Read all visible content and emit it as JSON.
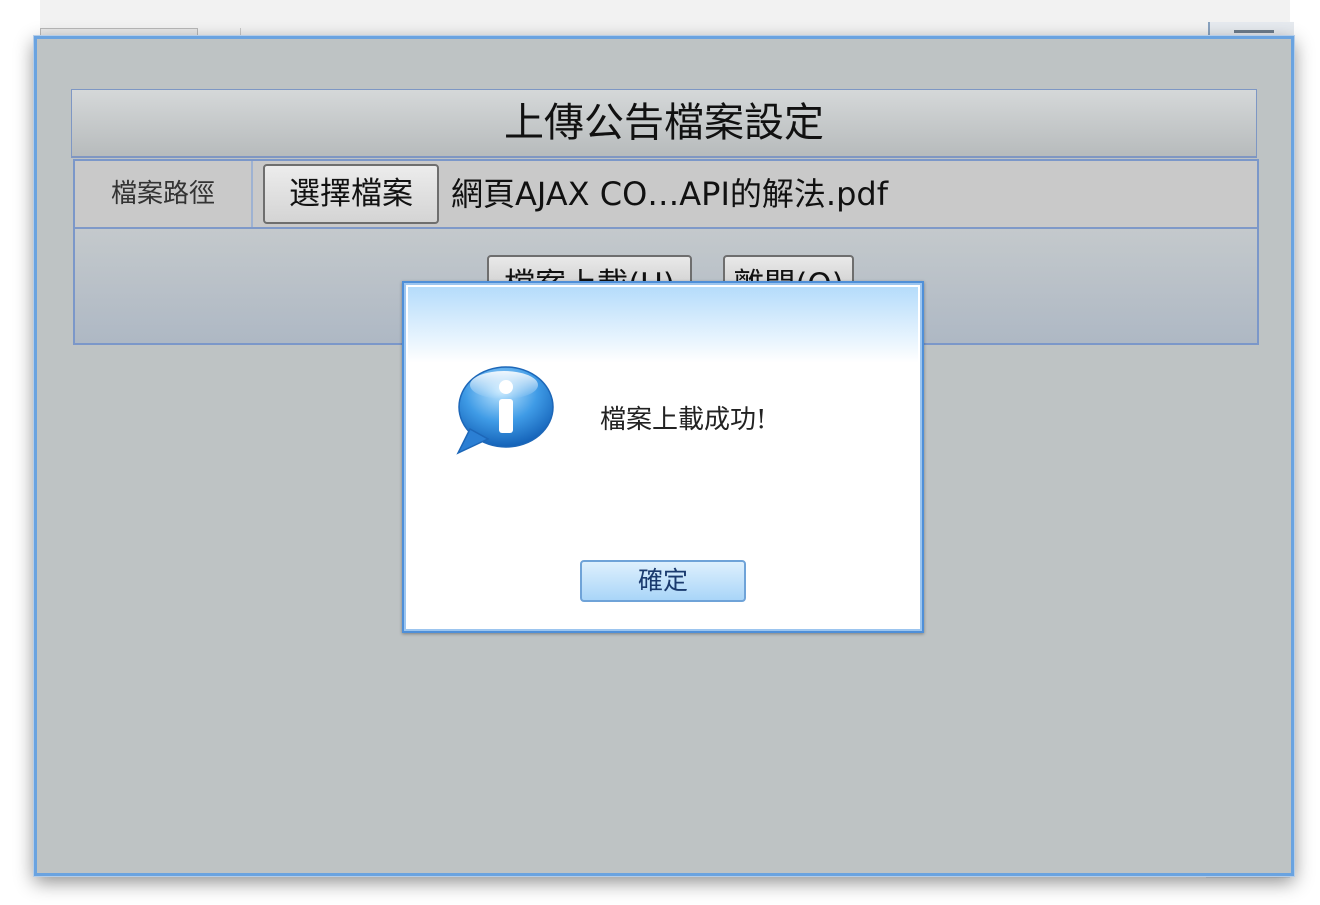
{
  "form": {
    "title": "上傳公告檔案設定",
    "file_label": "檔案路徑",
    "choose_button": "選擇檔案",
    "file_name": "網頁AJAX CO…API的解法.pdf",
    "upload_button": "檔案上載(U)",
    "leave_button": "離開(Q)"
  },
  "dialog": {
    "message": "檔案上載成功!",
    "ok_button": "確定",
    "icon": "info-icon"
  },
  "colors": {
    "window_border": "#6aa3e0",
    "window_background": "#bec3c4",
    "dialog_border": "#4f8fd8",
    "ok_button": "#a9d5f8"
  }
}
